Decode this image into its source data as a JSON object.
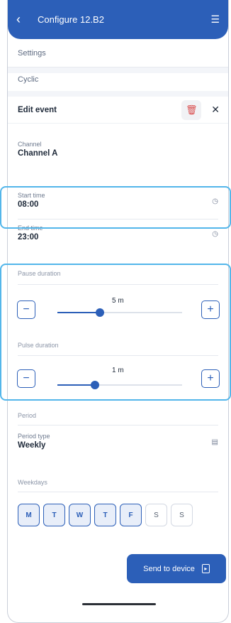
{
  "header": {
    "title": "Configure 12.B2",
    "back_icon": "chevron-left-icon",
    "menu_icon": "list-add-icon"
  },
  "sections": {
    "settings": "Settings",
    "cyclic": "Cyclic"
  },
  "edit_event": {
    "title": "Edit event",
    "delete_icon": "trash-icon",
    "close_icon": "close-icon"
  },
  "channel": {
    "caption": "Channel",
    "value": "Channel A"
  },
  "start_time": {
    "caption": "Start time",
    "value": "08:00"
  },
  "end_time": {
    "caption": "End time",
    "value": "23:00"
  },
  "pause": {
    "label": "Pause duration",
    "value": "5 m",
    "minus": "−",
    "plus": "+",
    "level": 0.34
  },
  "pulse": {
    "label": "Pulse duration",
    "value": "1 m",
    "minus": "−",
    "plus": "+",
    "level": 0.3
  },
  "period": {
    "label": "Period",
    "type_caption": "Period type",
    "type_value": "Weekly"
  },
  "weekdays": {
    "label": "Weekdays",
    "days": [
      {
        "label": "M",
        "selected": true
      },
      {
        "label": "T",
        "selected": true
      },
      {
        "label": "W",
        "selected": true
      },
      {
        "label": "T",
        "selected": true
      },
      {
        "label": "F",
        "selected": true
      },
      {
        "label": "S",
        "selected": false
      },
      {
        "label": "S",
        "selected": false
      }
    ]
  },
  "send": {
    "label": "Send to device",
    "icon": "send-device-icon"
  },
  "colors": {
    "primary": "#2c5fb8",
    "highlight": "#53b6ea",
    "danger": "#d94b4b"
  }
}
